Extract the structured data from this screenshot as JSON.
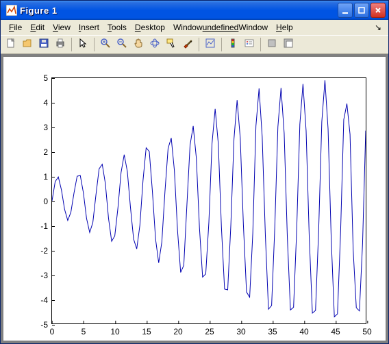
{
  "window": {
    "title": "Figure 1",
    "minimize_label": "Minimize",
    "maximize_label": "Maximize",
    "close_label": "Close",
    "corner_label": "↘"
  },
  "menu": {
    "file": "File",
    "file_ul": 0,
    "edit": "Edit",
    "edit_ul": 0,
    "view": "View",
    "view_ul": 0,
    "insert": "Insert",
    "insert_ul": 0,
    "tools": "Tools",
    "tools_ul": 0,
    "desktop": "Desktop",
    "desktop_ul": 0,
    "window_": "Window",
    "window_ul": 0,
    "help": "Help",
    "help_ul": 0
  },
  "toolbar": {
    "new": "New Figure",
    "open": "Open File",
    "save": "Save Figure",
    "print": "Print Figure",
    "pointer": "Edit Plot",
    "zoomin": "Zoom In",
    "zoomout": "Zoom Out",
    "pan": "Pan",
    "rotate": "Rotate 3D",
    "datacursor": "Data Cursor",
    "brush": "Brush",
    "link": "Link Plot",
    "colorbar": "Insert Colorbar",
    "legend": "Insert Legend",
    "hide": "Hide Plot Tools",
    "show": "Show Plot Tools"
  },
  "chart_data": {
    "type": "line",
    "title": "",
    "xlabel": "",
    "ylabel": "",
    "xlim": [
      0,
      50
    ],
    "ylim": [
      -5,
      5
    ],
    "xticks": [
      0,
      5,
      10,
      15,
      20,
      25,
      30,
      35,
      40,
      45,
      50
    ],
    "yticks": [
      -5,
      -4,
      -3,
      -2,
      -1,
      0,
      1,
      2,
      3,
      4,
      5
    ],
    "x": [
      0,
      0.5,
      1,
      1.5,
      2,
      2.5,
      3,
      3.5,
      4,
      4.5,
      5,
      5.5,
      6,
      6.5,
      7,
      7.5,
      8,
      8.5,
      9,
      9.5,
      10,
      10.5,
      11,
      11.5,
      12,
      12.5,
      13,
      13.5,
      14,
      14.5,
      15,
      15.5,
      16,
      16.5,
      17,
      17.5,
      18,
      18.5,
      19,
      19.5,
      20,
      20.5,
      21,
      21.5,
      22,
      22.5,
      23,
      23.5,
      24,
      24.5,
      25,
      25.5,
      26,
      26.5,
      27,
      27.5,
      28,
      28.5,
      29,
      29.5,
      30,
      30.5,
      31,
      31.5,
      32,
      32.5,
      33,
      33.5,
      34,
      34.5,
      35,
      35.5,
      36,
      36.5,
      37,
      37.5,
      38,
      38.5,
      39,
      39.5,
      40,
      40.5,
      41,
      41.5,
      42,
      42.5,
      43,
      43.5,
      44,
      44.5,
      45,
      45.5,
      46,
      46.5,
      47,
      47.5,
      48,
      48.5,
      49,
      49.5,
      50
    ],
    "y": [
      0,
      0.78,
      0.97,
      0.44,
      -0.35,
      -0.8,
      -0.47,
      0.32,
      1.0,
      1.03,
      0.32,
      -0.72,
      -1.29,
      -0.89,
      0.25,
      1.3,
      1.49,
      0.7,
      -0.71,
      -1.65,
      -1.43,
      -0.3,
      1.15,
      1.88,
      1.2,
      -0.27,
      -1.56,
      -1.96,
      -1.0,
      0.83,
      2.16,
      2.01,
      0.37,
      -1.56,
      -2.53,
      -1.68,
      0.38,
      2.14,
      2.56,
      1.24,
      -1.2,
      -2.92,
      -2.63,
      -0.15,
      2.27,
      3.05,
      1.74,
      -1.11,
      -3.11,
      -2.98,
      -0.87,
      2.33,
      3.75,
      2.33,
      -1.08,
      -3.6,
      -3.63,
      -0.99,
      2.52,
      4.1,
      2.56,
      -0.97,
      -3.72,
      -3.93,
      -1.33,
      3.05,
      4.58,
      2.61,
      -1.38,
      -4.42,
      -4.27,
      -1.13,
      3.01,
      4.6,
      2.76,
      -1.44,
      -4.45,
      -4.34,
      -1.16,
      3.12,
      4.76,
      2.85,
      -1.49,
      -4.58,
      -4.47,
      -1.2,
      3.22,
      4.91,
      2.93,
      -1.54,
      -4.73,
      -4.61,
      -1.23,
      3.31,
      3.96,
      2.71,
      -2.0,
      -4.36,
      -4.49,
      -1.73,
      2.86
    ],
    "line_color": "#0000b0"
  }
}
